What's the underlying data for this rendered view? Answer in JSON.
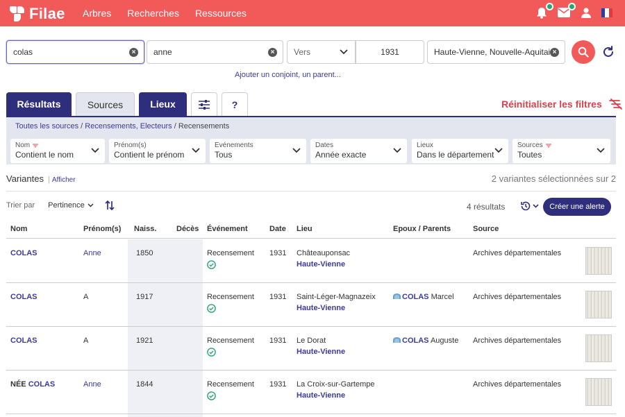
{
  "app": {
    "logo_text": "Filae",
    "brand_color": "#f25a5a",
    "accent_color": "#2e2e7c"
  },
  "nav": {
    "items": [
      "Arbres",
      "Recherches",
      "Ressources"
    ]
  },
  "search": {
    "surname_value": "colas",
    "firstname_value": "anne",
    "date_mode": "Vers",
    "year_value": "1931",
    "place_value": "Haute-Vienne, Nouvelle-Aquitaine,",
    "add_link": "Ajouter un conjoint, un parent..."
  },
  "tabs": {
    "results": "Résultats",
    "sources": "Sources",
    "places": "Lieux",
    "help": "?"
  },
  "reset_filters": "Réinitialiser les filtres",
  "breadcrumb": {
    "item1": "Toutes les sources",
    "sep": "/",
    "item2": "Recensements, Electeurs",
    "item3": "Recensements"
  },
  "filters": [
    {
      "label": "Nom",
      "value": "Contient le nom"
    },
    {
      "label": "Prénom(s)",
      "value": "Contient le prénom"
    },
    {
      "label": "Evénements",
      "value": "Tous"
    },
    {
      "label": "Dates",
      "value": "Année exacte"
    },
    {
      "label": "Lieux",
      "value": "Dans le département"
    },
    {
      "label": "Sources",
      "value": "Toutes"
    }
  ],
  "variants": {
    "label": "Variantes",
    "show": "Afficher",
    "selected": "2 variantes sélectionnées sur 2"
  },
  "sort": {
    "label": "Trier par",
    "value": "Pertinence"
  },
  "results_count": "4 résultats",
  "create_alert": "Créer une alerte",
  "table": {
    "headers": [
      "Nom",
      "Prénom(s)",
      "Naiss.",
      "Décès",
      "Événement",
      "Date",
      "Lieu",
      "Epoux / Parents",
      "Source"
    ],
    "rows": [
      {
        "prefix": "",
        "nom": "COLAS",
        "prenom": "Anne",
        "naiss": "1850",
        "deces": "",
        "event": "Recensement",
        "date": "1931",
        "lieu": "Châteauponsac",
        "dept": "Haute-Vienne",
        "spouse_surname": "",
        "spouse_first": "",
        "source": "Archives départementales"
      },
      {
        "prefix": "",
        "nom": "COLAS",
        "prenom": "A",
        "naiss": "1917",
        "deces": "",
        "event": "Recensement",
        "date": "1931",
        "lieu": "Saint-Léger-Magnazeix",
        "dept": "Haute-Vienne",
        "spouse_surname": "COLAS",
        "spouse_first": "Marcel",
        "source": "Archives départementales"
      },
      {
        "prefix": "",
        "nom": "COLAS",
        "prenom": "A",
        "naiss": "1921",
        "deces": "",
        "event": "Recensement",
        "date": "1931",
        "lieu": "Le Dorat",
        "dept": "Haute-Vienne",
        "spouse_surname": "COLAS",
        "spouse_first": "Auguste",
        "source": "Archives départementales"
      },
      {
        "prefix": "NÉE",
        "nom": "COLAS",
        "prenom": "Anne",
        "naiss": "1844",
        "deces": "",
        "event": "Recensement",
        "date": "1931",
        "lieu": "La Croix-sur-Gartempe",
        "dept": "Haute-Vienne",
        "spouse_surname": "",
        "spouse_first": "",
        "source": "Archives départementales"
      }
    ]
  }
}
